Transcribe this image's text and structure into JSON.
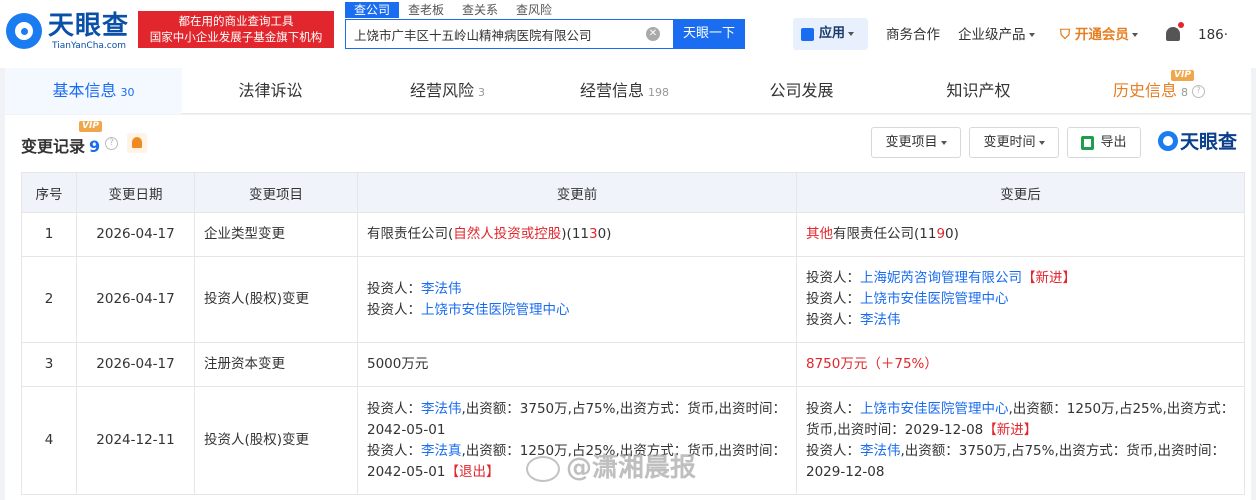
{
  "brand": {
    "name_cn": "天眼查",
    "name_en": "TianYanCha.com",
    "slogan_line1": "都在用的商业查询工具",
    "slogan_line2": "国家中小企业发展子基金旗下机构"
  },
  "search": {
    "tabs": [
      "查公司",
      "查老板",
      "查关系",
      "查风险"
    ],
    "query": "上饶市广丰区十五岭山精神病医院有限公司",
    "button": "天眼一下"
  },
  "topnav": {
    "app": "应用",
    "business": "商务合作",
    "enterprise": "企业级产品",
    "vip": "开通会员",
    "user": "186·"
  },
  "tabs": [
    {
      "label": "基本信息",
      "count": "30"
    },
    {
      "label": "法律诉讼",
      "count": ""
    },
    {
      "label": "经营风险",
      "count": "3"
    },
    {
      "label": "经营信息",
      "count": "198"
    },
    {
      "label": "公司发展",
      "count": ""
    },
    {
      "label": "知识产权",
      "count": ""
    },
    {
      "label": "历史信息",
      "count": "8",
      "vip": "VIP"
    }
  ],
  "section": {
    "title": "变更记录",
    "count": "9",
    "vip": "VIP",
    "filter_item": "变更项目",
    "filter_time": "变更时间",
    "export": "导出",
    "brand": "天眼查"
  },
  "table": {
    "headers": [
      "序号",
      "变更日期",
      "变更项目",
      "变更前",
      "变更后"
    ],
    "rows": [
      {
        "no": "1",
        "date": "2026-04-17",
        "item": "企业类型变更"
      },
      {
        "no": "2",
        "date": "2026-04-17",
        "item": "投资人(股权)变更"
      },
      {
        "no": "3",
        "date": "2026-04-17",
        "item": "注册资本变更"
      },
      {
        "no": "4",
        "date": "2024-12-11",
        "item": "投资人(股权)变更"
      }
    ],
    "r1": {
      "before_a": "有限责任公司(",
      "before_b": "自然人投资或控股",
      "before_c": ")(11",
      "before_d": "3",
      "before_e": "0)",
      "after_a": "其他",
      "after_b": "有限责任公司(11",
      "after_c": "9",
      "after_d": "0)"
    },
    "r2": {
      "label": "投资人：",
      "before_1": "李法伟",
      "before_2": "上饶市安佳医院管理中心",
      "after_1": "上海妮芮咨询管理有限公司",
      "after_1_tag": "【新进】",
      "after_2": "上饶市安佳医院管理中心",
      "after_3": "李法伟"
    },
    "r3": {
      "before": "5000万元",
      "after": "8750万元（＋75%）"
    },
    "r4": {
      "label": "投资人：",
      "b1_name": "李法伟",
      "b1_text": ",出资额：3750万,占75%,出资方式：货币,出资时间：2042-05-01",
      "b2_name": "李法真",
      "b2_text": ",出资额：1250万,占25%,出资方式：货币,出资时间：2042-05-01",
      "b2_tag": "【退出】",
      "a1_name": "上饶市安佳医院管理中心",
      "a1_text": ",出资额：1250万,占25%,出资方式：货币,出资时间：2029-12-08",
      "a1_tag": "【新进】",
      "a2_name": "李法伟",
      "a2_text": ",出资额：3750万,占75%,出资方式：货币,出资时间：2029-12-08"
    }
  },
  "watermark": "@潇湘晨报"
}
